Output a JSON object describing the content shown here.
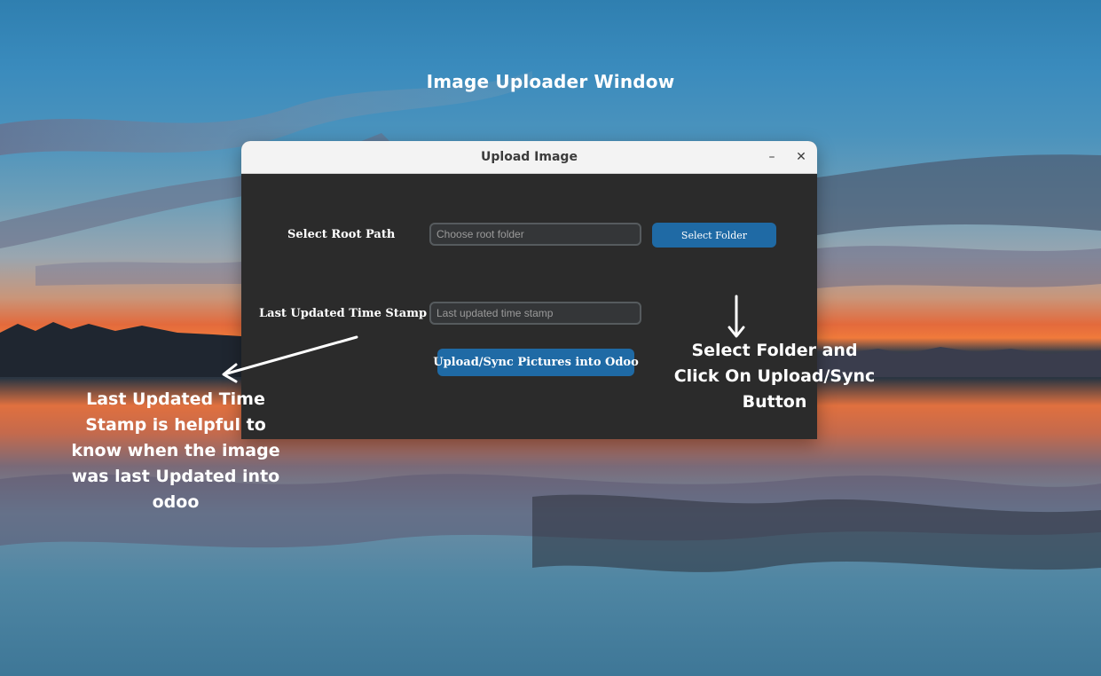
{
  "page": {
    "headline": "Image Uploader Window"
  },
  "window": {
    "title": "Upload Image",
    "minimize_icon": "minimize-icon",
    "close_icon": "close-icon",
    "minimize_glyph": "–",
    "close_glyph": "✕"
  },
  "form": {
    "root_path_label": "Select Root Path",
    "root_path_placeholder": "Choose root folder",
    "select_folder_label": "Select Folder",
    "timestamp_label": "Last Updated Time Stamp",
    "timestamp_placeholder": "Last updated time stamp",
    "upload_label": "Upload/Sync Pictures into Odoo"
  },
  "annotations": {
    "left_note": "Last Updated Time Stamp is helpful to know when the image was last Updated into odoo",
    "right_note": "Select Folder and Click On Upload/Sync Button",
    "arrow_icon": "arrow-icon"
  },
  "colors": {
    "button_blue": "#1f6aa5",
    "window_bg": "#2b2b2b",
    "titlebar_bg": "#f3f3f3",
    "field_bg": "#343638",
    "field_border": "#565b5e"
  }
}
